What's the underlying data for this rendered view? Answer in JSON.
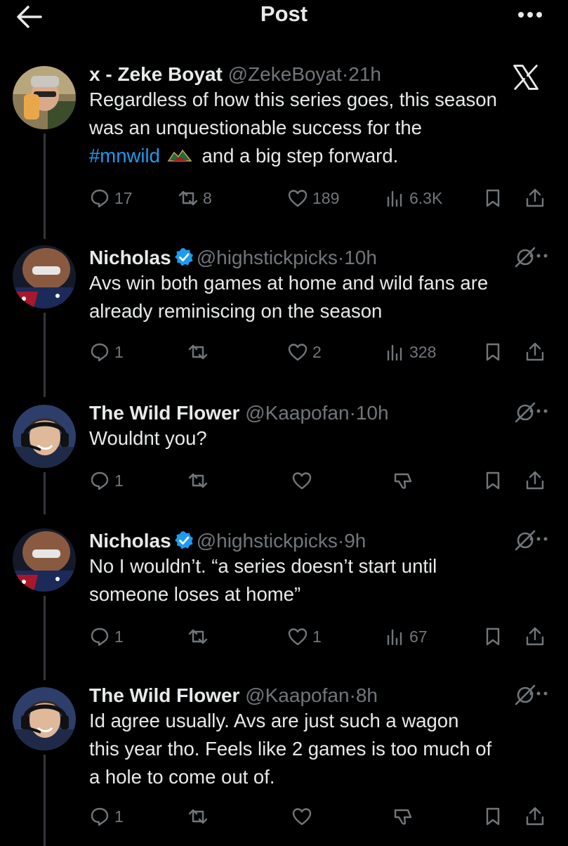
{
  "header": {
    "title": "Post"
  },
  "tweets": [
    {
      "name": "x - Zeke Boyat",
      "handle": "@ZekeBoyat",
      "dot": "·",
      "time": "21h",
      "lines": [
        "Regardless of how this series goes, this season",
        "was an unquestionable success for the"
      ],
      "hashtag": "#mnwild",
      "hashtag_after": "and a big step forward.",
      "replies": "17",
      "reposts": "8",
      "likes": "189",
      "views": "6.3K"
    },
    {
      "name": "Nicholas",
      "handle": "@highstickpicks",
      "dot": "·",
      "time": "10h",
      "lines": [
        "Avs win both games at home and wild fans are",
        "already reminiscing on the season"
      ],
      "replies": "1",
      "reposts": "",
      "likes": "2",
      "views": "328"
    },
    {
      "name": "The Wild Flower",
      "handle": "@Kaapofan",
      "dot": "·",
      "time": "10h",
      "lines": [
        "Wouldnt you?"
      ],
      "replies": "1"
    },
    {
      "name": "Nicholas",
      "handle": "@highstickpicks",
      "dot": "·",
      "time": "9h",
      "lines": [
        "No I wouldn’t. “a series doesn’t start until",
        "someone loses at home”"
      ],
      "replies": "1",
      "reposts": "",
      "likes": "1",
      "views": "67"
    },
    {
      "name": "The Wild Flower",
      "handle": "@Kaapofan",
      "dot": "·",
      "time": "8h",
      "lines": [
        "Id agree usually. Avs are just such a wagon",
        "this year tho. Feels like 2 games is too much of",
        "a hole to come out of."
      ],
      "replies": "1"
    }
  ],
  "colors": {
    "background": "#000000",
    "text": "#e7e9ea",
    "muted": "#71767b",
    "link": "#1d9bf0",
    "verified": "#1d9bf0"
  }
}
